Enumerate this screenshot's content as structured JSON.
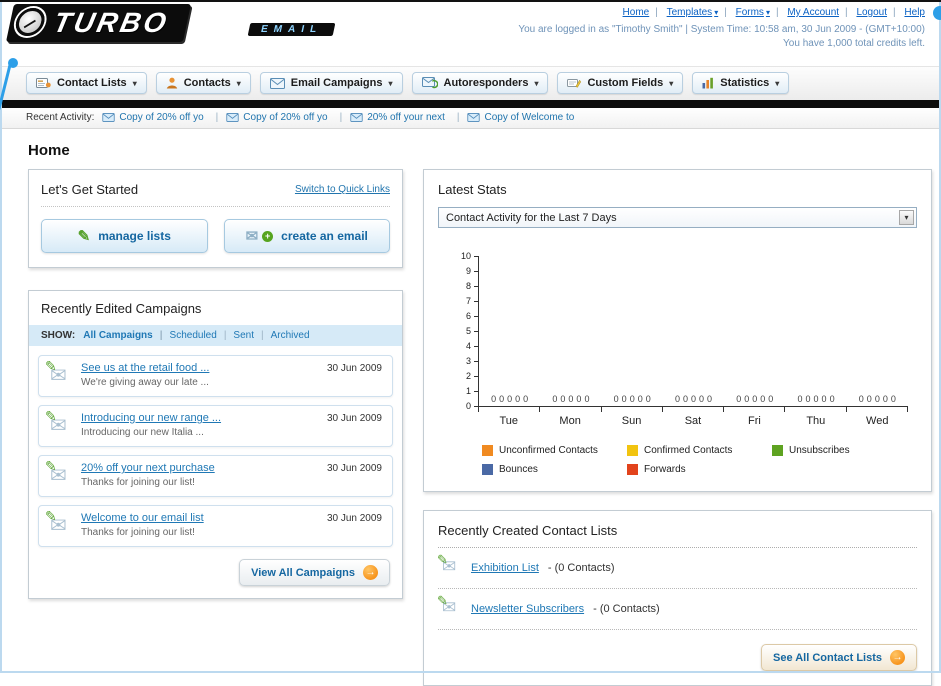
{
  "icons": {
    "caret_down": "▾",
    "envelope": "✉",
    "pencil": "✎",
    "plus": "+",
    "arrow_right": "→"
  },
  "header": {
    "logo_title": "TURBO",
    "logo_subtitle": "EMAIL",
    "nav_links": [
      "Home",
      "Templates",
      "Forms",
      "My Account",
      "Logout",
      "Help"
    ],
    "login_info": "You are logged in as \"Timothy Smith\" | System Time: 10:58 am, 30 Jun 2009 - (GMT+10:00)",
    "credits_info": "You have 1,000 total credits left."
  },
  "nav_tabs": [
    {
      "label": "Contact Lists",
      "icon": "contact-lists-icon"
    },
    {
      "label": "Contacts",
      "icon": "contacts-icon"
    },
    {
      "label": "Email Campaigns",
      "icon": "email-campaigns-icon"
    },
    {
      "label": "Autoresponders",
      "icon": "autoresponders-icon"
    },
    {
      "label": "Custom Fields",
      "icon": "custom-fields-icon"
    },
    {
      "label": "Statistics",
      "icon": "statistics-icon"
    }
  ],
  "recent_activity": {
    "label": "Recent Activity:",
    "items": [
      "Copy of 20% off yo",
      "Copy of 20% off yo",
      "20% off your next",
      "Copy of Welcome to"
    ]
  },
  "page_title": "Home",
  "get_started": {
    "title": "Let's Get Started",
    "switch_link": "Switch to Quick Links",
    "manage_lists_label": "manage lists",
    "create_email_label": "create an email"
  },
  "campaigns": {
    "title": "Recently Edited Campaigns",
    "show_label": "SHOW:",
    "tabs": [
      "All Campaigns",
      "Scheduled",
      "Sent",
      "Archived"
    ],
    "items": [
      {
        "title": "See us at the retail food ...",
        "subtitle": "We're giving away our late ...",
        "date": "30 Jun 2009"
      },
      {
        "title": "Introducing our new range ...",
        "subtitle": "Introducing our new Italia ...",
        "date": "30 Jun 2009"
      },
      {
        "title": "20% off your next purchase",
        "subtitle": "Thanks for joining our list!",
        "date": "30 Jun 2009"
      },
      {
        "title": "Welcome to our email list",
        "subtitle": "Thanks for joining our list!",
        "date": "30 Jun 2009"
      }
    ],
    "view_all_label": "View All Campaigns"
  },
  "stats": {
    "title": "Latest Stats",
    "dropdown_value": "Contact Activity for the Last 7 Days"
  },
  "chart_data": {
    "type": "bar",
    "title": "Contact Activity for the Last 7 Days",
    "categories": [
      "Tue",
      "Mon",
      "Sun",
      "Sat",
      "Fri",
      "Thu",
      "Wed"
    ],
    "series": [
      {
        "name": "Unconfirmed Contacts",
        "color": "#f08a21",
        "values": [
          0,
          0,
          0,
          0,
          0,
          0,
          0
        ]
      },
      {
        "name": "Confirmed Contacts",
        "color": "#f2c410",
        "values": [
          0,
          0,
          0,
          0,
          0,
          0,
          0
        ]
      },
      {
        "name": "Unsubscribes",
        "color": "#5ea321",
        "values": [
          0,
          0,
          0,
          0,
          0,
          0,
          0
        ]
      },
      {
        "name": "Bounces",
        "color": "#4a69a5",
        "values": [
          0,
          0,
          0,
          0,
          0,
          0,
          0
        ]
      },
      {
        "name": "Forwards",
        "color": "#e2431c",
        "values": [
          0,
          0,
          0,
          0,
          0,
          0,
          0
        ]
      }
    ],
    "ylim": [
      0,
      10
    ],
    "yticks": [
      0,
      1,
      2,
      3,
      4,
      5,
      6,
      7,
      8,
      9,
      10
    ],
    "grid": false,
    "legend_position": "bottom",
    "data_labels": true
  },
  "contact_lists": {
    "title": "Recently Created Contact Lists",
    "items": [
      {
        "name": "Exhibition List",
        "suffix": "- (0 Contacts)"
      },
      {
        "name": "Newsletter Subscribers",
        "suffix": "- (0 Contacts)"
      }
    ],
    "see_all_label": "See All Contact Lists"
  }
}
